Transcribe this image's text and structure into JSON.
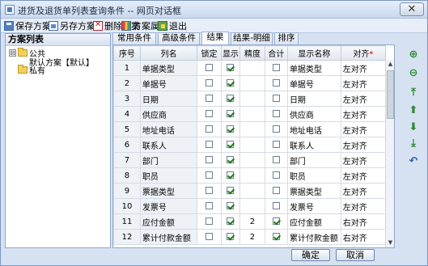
{
  "window": {
    "title": "进货及退货单列表查询条件 -- 网页对话框",
    "close_label": "✕"
  },
  "toolbar": {
    "items": [
      {
        "label": "保存方案",
        "icon": "save-icon"
      },
      {
        "label": "另存方案",
        "icon": "save-as-icon"
      },
      {
        "label": "删除方案",
        "icon": "delete-icon"
      },
      {
        "label": "方案属性",
        "icon": "properties-icon"
      },
      {
        "label": "退出",
        "icon": "exit-icon"
      }
    ]
  },
  "scheme_panel": {
    "title": "方案列表",
    "tree": [
      {
        "label": "公共",
        "toggle": "⊟"
      },
      {
        "label": "默认方案【默认】"
      },
      {
        "label": "私有"
      }
    ]
  },
  "tabs": [
    "常用条件",
    "高级条件",
    "结果",
    "结果-明细",
    "排序"
  ],
  "active_tab": "结果",
  "grid": {
    "headers": [
      "序号",
      "列名",
      "锁定",
      "显示",
      "精度",
      "合计",
      "显示名称",
      "对齐"
    ],
    "required_mark": "*",
    "rows": [
      {
        "no": "1",
        "name": "单据类型",
        "locked": false,
        "show": true,
        "precision": "",
        "sum": false,
        "display": "单据类型",
        "align": "左对齐"
      },
      {
        "no": "2",
        "name": "单据号",
        "locked": false,
        "show": true,
        "precision": "",
        "sum": false,
        "display": "单据号",
        "align": "左对齐"
      },
      {
        "no": "3",
        "name": "日期",
        "locked": false,
        "show": true,
        "precision": "",
        "sum": false,
        "display": "日期",
        "align": "左对齐"
      },
      {
        "no": "4",
        "name": "供应商",
        "locked": false,
        "show": true,
        "precision": "",
        "sum": false,
        "display": "供应商",
        "align": "左对齐"
      },
      {
        "no": "5",
        "name": "地址电话",
        "locked": false,
        "show": true,
        "precision": "",
        "sum": false,
        "display": "地址电话",
        "align": "左对齐"
      },
      {
        "no": "6",
        "name": "联系人",
        "locked": false,
        "show": true,
        "precision": "",
        "sum": false,
        "display": "联系人",
        "align": "左对齐"
      },
      {
        "no": "7",
        "name": "部门",
        "locked": false,
        "show": true,
        "precision": "",
        "sum": false,
        "display": "部门",
        "align": "左对齐"
      },
      {
        "no": "8",
        "name": "职员",
        "locked": false,
        "show": true,
        "precision": "",
        "sum": false,
        "display": "职员",
        "align": "左对齐"
      },
      {
        "no": "9",
        "name": "票据类型",
        "locked": false,
        "show": true,
        "precision": "",
        "sum": false,
        "display": "票据类型",
        "align": "左对齐"
      },
      {
        "no": "10",
        "name": "发票号",
        "locked": false,
        "show": true,
        "precision": "",
        "sum": false,
        "display": "发票号",
        "align": "左对齐"
      },
      {
        "no": "11",
        "name": "应付金额",
        "locked": false,
        "show": true,
        "precision": "2",
        "sum": true,
        "display": "应付金额",
        "align": "右对齐"
      },
      {
        "no": "12",
        "name": "累计付款金额",
        "locked": false,
        "show": true,
        "precision": "2",
        "sum": true,
        "display": "累计付款金额",
        "align": "右对齐"
      }
    ]
  },
  "side_tools": [
    {
      "icon": "add-row-icon",
      "glyph": "⊕"
    },
    {
      "icon": "delete-row-icon",
      "glyph": "⊖"
    },
    {
      "icon": "move-top-icon",
      "glyph": "⤒"
    },
    {
      "icon": "move-up-icon",
      "glyph": "⬆"
    },
    {
      "icon": "move-down-icon",
      "glyph": "⬇"
    },
    {
      "icon": "move-bottom-icon",
      "glyph": "⤓"
    },
    {
      "icon": "undo-icon",
      "glyph": "↶"
    }
  ],
  "buttons": {
    "ok": "确定",
    "cancel": "取消"
  },
  "colors": {
    "accent": "#4f7fc8",
    "check": "#1f7a1f",
    "required": "#dd0000"
  }
}
